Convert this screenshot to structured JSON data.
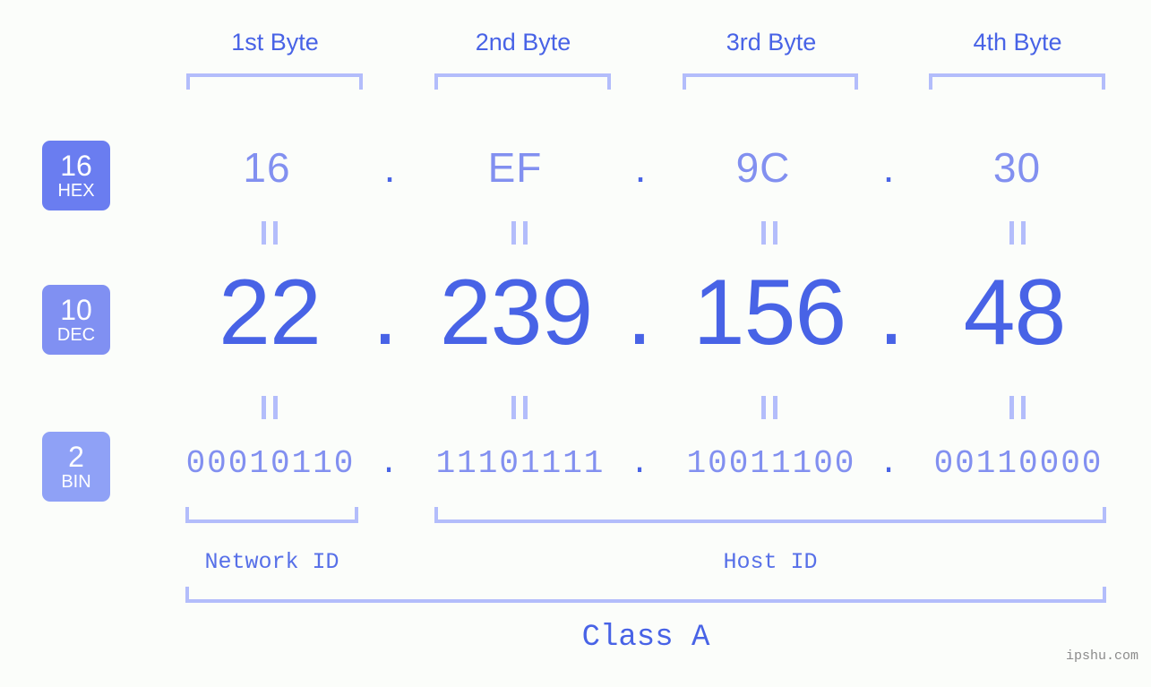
{
  "theme": {
    "background": "#fbfdfa",
    "accent_strong": "#4863e6",
    "accent_mid": "#8290f0",
    "accent_light": "#b3bdfb",
    "badge_hex": "#6a7df0",
    "badge_dec": "#8090f2",
    "badge_bin": "#8fa1f6",
    "watermark_color": "#8b8b8b"
  },
  "byte_headers": [
    {
      "label": "1st Byte"
    },
    {
      "label": "2nd Byte"
    },
    {
      "label": "3rd Byte"
    },
    {
      "label": "4th Byte"
    }
  ],
  "rows": [
    {
      "badge": {
        "num": "16",
        "abbr": "HEX"
      },
      "separator": ".",
      "values": [
        "16",
        "EF",
        "9C",
        "30"
      ]
    },
    {
      "badge": {
        "num": "10",
        "abbr": "DEC"
      },
      "separator": ".",
      "values": [
        "22",
        "239",
        "156",
        "48"
      ]
    },
    {
      "badge": {
        "num": "2",
        "abbr": "BIN"
      },
      "separator": ".",
      "values": [
        "00010110",
        "11101111",
        "10011100",
        "00110000"
      ]
    }
  ],
  "segments": {
    "network_id": "Network ID",
    "host_id": "Host ID",
    "class": "Class A"
  },
  "watermark": "ipshu.com"
}
